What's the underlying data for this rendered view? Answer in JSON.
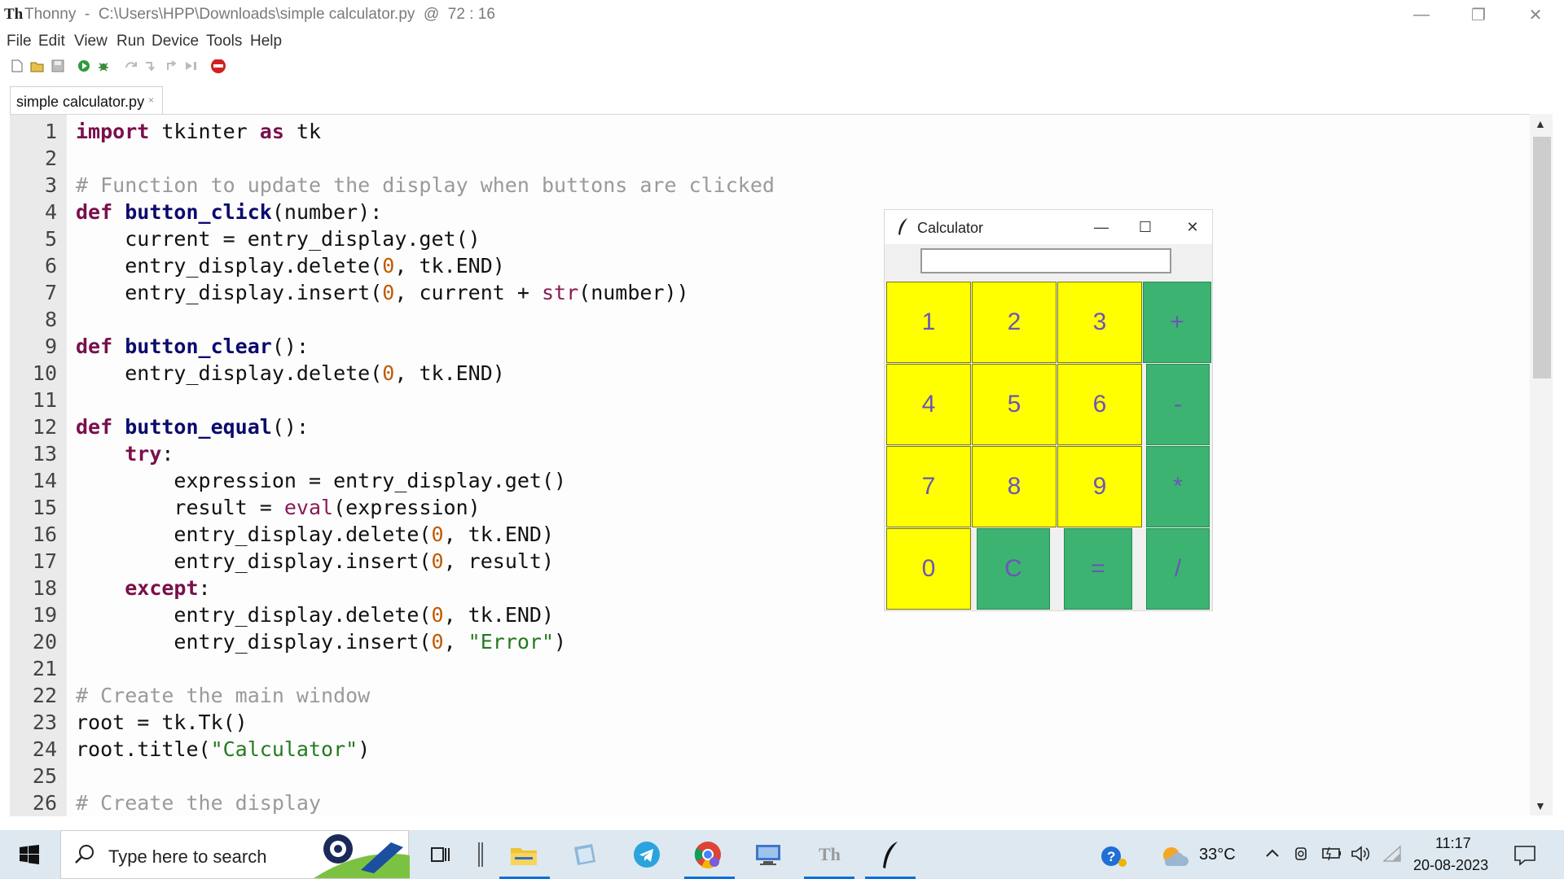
{
  "window": {
    "logo": "Th",
    "title": "Thonny  -  C:\\Users\\HPP\\Downloads\\simple calculator.py  @  72 : 16",
    "controls": {
      "minimize": "—",
      "restore": "❐",
      "close": "✕"
    }
  },
  "menu": [
    "File",
    "Edit",
    "View",
    "Run",
    "Device",
    "Tools",
    "Help"
  ],
  "toolbar": [
    "new-file-icon",
    "open-file-icon",
    "save-icon",
    "run-icon",
    "debug-icon",
    "step-over-icon",
    "step-into-icon",
    "step-out-icon",
    "resume-icon",
    "stop-icon"
  ],
  "tab": {
    "label": "simple calculator.py",
    "close": "×"
  },
  "editor": {
    "line_numbers": [
      "1",
      "2",
      "3",
      "4",
      "5",
      "6",
      "7",
      "8",
      "9",
      "10",
      "11",
      "12",
      "13",
      "14",
      "15",
      "16",
      "17",
      "18",
      "19",
      "20",
      "21",
      "22",
      "23",
      "24",
      "25",
      "26"
    ],
    "lines": [
      "import tkinter as tk",
      "",
      "# Function to update the display when buttons are clicked",
      "def button_click(number):",
      "    current = entry_display.get()",
      "    entry_display.delete(0, tk.END)",
      "    entry_display.insert(0, current + str(number))",
      "",
      "def button_clear():",
      "    entry_display.delete(0, tk.END)",
      "",
      "def button_equal():",
      "    try:",
      "        expression = entry_display.get()",
      "        result = eval(expression)",
      "        entry_display.delete(0, tk.END)",
      "        entry_display.insert(0, result)",
      "    except:",
      "        entry_display.delete(0, tk.END)",
      "        entry_display.insert(0, \"Error\")",
      "",
      "# Create the main window",
      "root = tk.Tk()",
      "root.title(\"Calculator\")",
      "",
      "# Create the display"
    ]
  },
  "calculator": {
    "title": "Calculator",
    "display_value": "",
    "controls": {
      "minimize": "—",
      "maximize": "☐",
      "close": "✕"
    },
    "buttons": [
      "1",
      "2",
      "3",
      "+",
      "4",
      "5",
      "6",
      "-",
      "7",
      "8",
      "9",
      "*",
      "0",
      "C",
      "=",
      "/"
    ],
    "colors": {
      "number": "#ffff00",
      "operator": "#3cb371",
      "text": "#6b55b8"
    }
  },
  "taskbar": {
    "search_placeholder": "Type here to search",
    "apps": [
      "task-view-icon",
      "file-explorer-icon",
      "notes-icon",
      "telegram-icon",
      "chrome-icon",
      "remote-desktop-icon",
      "thonny-icon",
      "tk-feather-icon"
    ],
    "weather": "33°C",
    "time": "11:17",
    "date": "20-08-2023"
  }
}
